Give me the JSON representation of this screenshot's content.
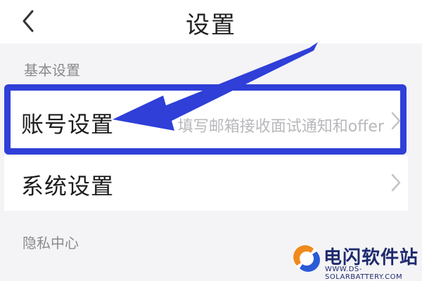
{
  "header": {
    "title": "设置",
    "back_icon": "chevron-left-icon"
  },
  "sections": {
    "basic_label": "基本设置",
    "privacy_label": "隐私中心"
  },
  "rows": {
    "account": {
      "label": "账号设置",
      "hint": "填写邮箱接收面试通知和offer",
      "chevron_icon": "chevron-right-icon"
    },
    "system": {
      "label": "系统设置",
      "chevron_icon": "chevron-right-icon"
    }
  },
  "annotation": {
    "color": "#2f3fd8"
  },
  "watermark": {
    "name": "电闪软件站",
    "url": "WWW.DS-SOLARBATTERY.COM",
    "logo_colors": [
      "#f08a1c",
      "#2a5bd7"
    ]
  }
}
